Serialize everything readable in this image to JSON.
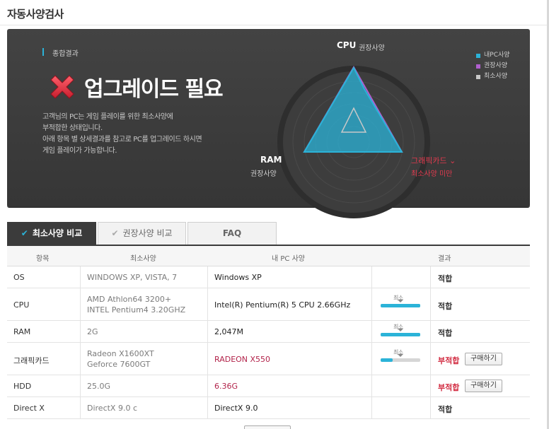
{
  "page": {
    "title": "자동사양검사"
  },
  "summary": {
    "section_label": "종합결과",
    "verdict": "업그레이드 필요",
    "description": [
      "고객님의 PC는 게임 플레이를 위한 최소사양에",
      "부적합한 상태입니다.",
      "아래 항목 별 상세결과를 참고로 PC를 업그레이드 하시면",
      "게임 플레이가 가능합니다."
    ]
  },
  "radar": {
    "cpu_label": "CPU",
    "cpu_sub": "권장사양",
    "ram_label": "RAM",
    "ram_sub": "권장사양",
    "gpu_label": "그래픽카드 ⌄",
    "gpu_sub": "최소사양 미만",
    "legend": [
      {
        "label": "내PC사양",
        "color": "#2bb3d8"
      },
      {
        "label": "권장사양",
        "color": "#b05fcf"
      },
      {
        "label": "최소사양",
        "color": "#c8c8c8"
      }
    ]
  },
  "tabs": [
    {
      "label": "최소사양 비교",
      "active": true
    },
    {
      "label": "권장사양 비교",
      "active": false
    },
    {
      "label": "FAQ",
      "active": false
    }
  ],
  "table": {
    "headers": {
      "item": "항목",
      "min": "최소사양",
      "my": "내 PC 사양",
      "result": "결과"
    },
    "rows": [
      {
        "item": "OS",
        "min": [
          "WINDOWS XP, VISTA, 7"
        ],
        "my": "Windows XP",
        "result": "적합",
        "bar": null,
        "buy": null
      },
      {
        "item": "CPU",
        "min": [
          "AMD Athlon64 3200+",
          "INTEL Pentium4 3.20GHZ"
        ],
        "my": "Intel(R) Pentium(R) 5 CPU 2.66GHz",
        "result": "적합",
        "bar": {
          "tag": "최소",
          "level": 1.0
        },
        "buy": null
      },
      {
        "item": "RAM",
        "min": [
          "2G"
        ],
        "my": "2,047M",
        "result": "적합",
        "bar": {
          "tag": "최소",
          "level": 1.0
        },
        "buy": null
      },
      {
        "item": "그래픽카드",
        "min": [
          "Radeon X1600XT",
          "Geforce 7600GT"
        ],
        "my": "RADEON X550",
        "result": "부적합",
        "bar": {
          "tag": "최소",
          "level": 0.3
        },
        "buy": "구매하기"
      },
      {
        "item": "HDD",
        "min": [
          "25.0G"
        ],
        "my": "6.36G",
        "result": "부적합",
        "bar": null,
        "buy": "구매하기"
      },
      {
        "item": "Direct X",
        "min": [
          "DirectX 9.0 c"
        ],
        "my": "DirectX 9.0",
        "result": "적합",
        "bar": null,
        "buy": null
      }
    ]
  }
}
